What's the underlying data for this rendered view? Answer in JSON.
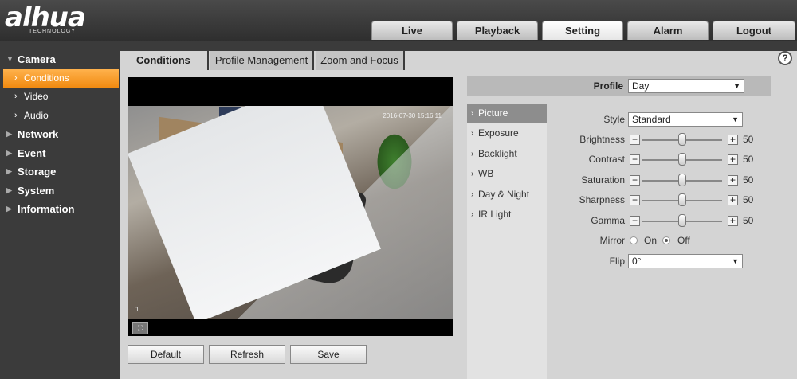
{
  "brand": {
    "name": "alhua",
    "sub": "TECHNOLOGY"
  },
  "nav": [
    {
      "label": "Live",
      "active": false
    },
    {
      "label": "Playback",
      "active": false
    },
    {
      "label": "Setting",
      "active": true
    },
    {
      "label": "Alarm",
      "active": false
    },
    {
      "label": "Logout",
      "active": false
    }
  ],
  "sidebar": {
    "camera": "Camera",
    "camera_children": [
      "Conditions",
      "Video",
      "Audio"
    ],
    "others": [
      "Network",
      "Event",
      "Storage",
      "System",
      "Information"
    ]
  },
  "subtabs": [
    "Conditions",
    "Profile Management",
    "Zoom and Focus"
  ],
  "help": "?",
  "video": {
    "timestamp": "2016-07-30 15:16:11",
    "channel": "1"
  },
  "buttons": {
    "default": "Default",
    "refresh": "Refresh",
    "save": "Save"
  },
  "profile": {
    "label": "Profile",
    "value": "Day"
  },
  "menu": [
    "Picture",
    "Exposure",
    "Backlight",
    "WB",
    "Day & Night",
    "IR Light"
  ],
  "settings": {
    "style_label": "Style",
    "style_value": "Standard",
    "sliders": [
      {
        "label": "Brightness",
        "value": "50",
        "level": 0.5
      },
      {
        "label": "Contrast",
        "value": "50",
        "level": 0.5
      },
      {
        "label": "Saturation",
        "value": "50",
        "level": 0.5
      },
      {
        "label": "Sharpness",
        "value": "50",
        "level": 0.5
      },
      {
        "label": "Gamma",
        "value": "50",
        "level": 0.5
      }
    ],
    "mirror_label": "Mirror",
    "mirror_on": "On",
    "mirror_off": "Off",
    "mirror_selected": "Off",
    "flip_label": "Flip",
    "flip_value": "0°"
  }
}
